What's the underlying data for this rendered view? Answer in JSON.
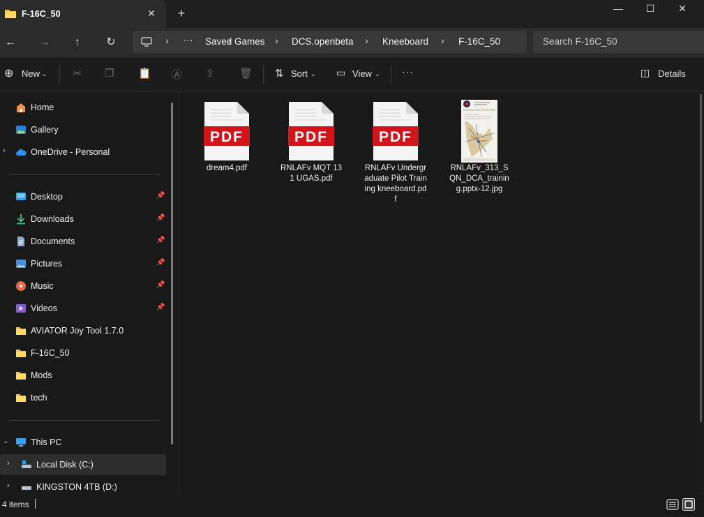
{
  "window": {
    "tab_title": "F-16C_50",
    "close_tab_glyph": "✕",
    "new_tab_glyph": "+",
    "minimize_glyph": "—",
    "maximize_glyph": "☐",
    "close_glyph": "✕"
  },
  "address": {
    "overflow": "···",
    "breadcrumb": [
      "Saved Games",
      "DCS.openbeta",
      "Kneeboard",
      "F-16C_50"
    ],
    "search_placeholder": "Search F-16C_50"
  },
  "toolbar": {
    "new_label": "New",
    "sort_label": "Sort",
    "view_label": "View",
    "more_glyph": "···",
    "details_label": "Details"
  },
  "sidebar": {
    "quick": [
      {
        "label": "Home",
        "icon": "home-icon"
      },
      {
        "label": "Gallery",
        "icon": "gallery-icon"
      },
      {
        "label": "OneDrive - Personal",
        "icon": "cloud-icon"
      }
    ],
    "pinned": [
      {
        "label": "Desktop",
        "icon": "desktop-icon"
      },
      {
        "label": "Downloads",
        "icon": "download-icon"
      },
      {
        "label": "Documents",
        "icon": "documents-icon"
      },
      {
        "label": "Pictures",
        "icon": "pictures-icon"
      },
      {
        "label": "Music",
        "icon": "music-icon"
      },
      {
        "label": "Videos",
        "icon": "videos-icon"
      }
    ],
    "folders": [
      "AVIATOR Joy Tool 1.7.0",
      "F-16C_50",
      "Mods",
      "tech"
    ],
    "this_pc": "This PC",
    "drives": [
      "Local Disk (C:)",
      "KINGSTON 4TB (D:)"
    ]
  },
  "files": [
    {
      "name": "dream4.pdf",
      "type": "pdf",
      "badge": "PDF"
    },
    {
      "name": "RNLAFv MQT 131 UGAS.pdf",
      "type": "pdf",
      "badge": "PDF"
    },
    {
      "name": "RNLAFv Undergraduate Pilot Training kneeboard.pdf",
      "type": "pdf",
      "badge": "PDF"
    },
    {
      "name": "RNLAFv_313_SQN_DCA_training.pptx-12.jpg",
      "type": "jpg"
    }
  ],
  "status": {
    "item_count": "4 items"
  },
  "colors": {
    "pdf_red": "#d0161b",
    "folder_yellow": "#f4c542",
    "accent_blue": "#4aa3f0"
  }
}
